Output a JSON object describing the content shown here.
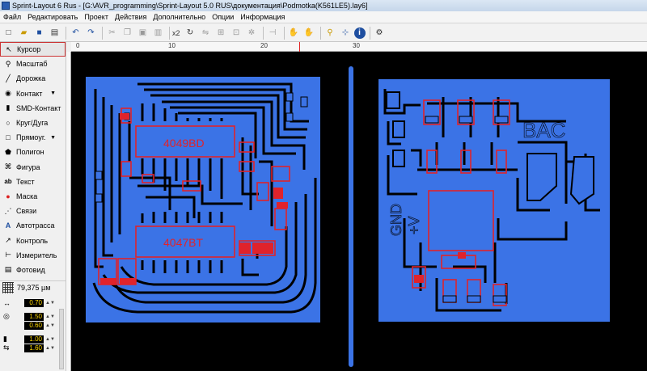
{
  "window": {
    "title": "Sprint-Layout 6 Rus - [G:\\AVR_programming\\Sprint-Layout 5.0 RUS\\документация\\Podmotka(K561LE5).lay6]"
  },
  "menu": [
    "Файл",
    "Редактировать",
    "Проект",
    "Действия",
    "Дополнительно",
    "Опции",
    "Информация"
  ],
  "toolbar": {
    "zoom_label": "x2"
  },
  "sidebar": {
    "tools": [
      {
        "label": "Курсор",
        "icon": "cursor-icon"
      },
      {
        "label": "Масштаб",
        "icon": "zoom-icon"
      },
      {
        "label": "Дорожка",
        "icon": "track-icon"
      },
      {
        "label": "Контакт",
        "icon": "pad-icon"
      },
      {
        "label": "SMD-Контакт",
        "icon": "smd-pad-icon"
      },
      {
        "label": "Круг/Дуга",
        "icon": "circle-icon"
      },
      {
        "label": "Прямоуг.",
        "icon": "rectangle-icon"
      },
      {
        "label": "Полигон",
        "icon": "polygon-icon"
      },
      {
        "label": "Фигура",
        "icon": "shape-icon"
      },
      {
        "label": "Текст",
        "icon": "text-icon"
      },
      {
        "label": "Маска",
        "icon": "mask-icon"
      },
      {
        "label": "Связи",
        "icon": "connections-icon"
      },
      {
        "label": "Автотрасса",
        "icon": "autoroute-icon"
      },
      {
        "label": "Контроль",
        "icon": "drc-icon"
      },
      {
        "label": "Измеритель",
        "icon": "measure-icon"
      },
      {
        "label": "Фотовид",
        "icon": "photoview-icon"
      }
    ],
    "grid_value": "79,375 µм",
    "params": {
      "track_width": "0.70",
      "pad_outer": "1.50",
      "pad_inner": "0.60",
      "smd_width": "1.00",
      "smd_height": "1.60"
    }
  },
  "ruler": {
    "labels": [
      "0",
      "10",
      "20",
      "30"
    ]
  },
  "board": {
    "ic1_label": "4049BD",
    "ic2_label": "4047BT",
    "vac_label": "BAC",
    "gnd_label": "GND",
    "vplus_label": "+V",
    "colors": {
      "copper": "#3b73e6",
      "silk": "#e0232b",
      "background": "#000000"
    }
  }
}
